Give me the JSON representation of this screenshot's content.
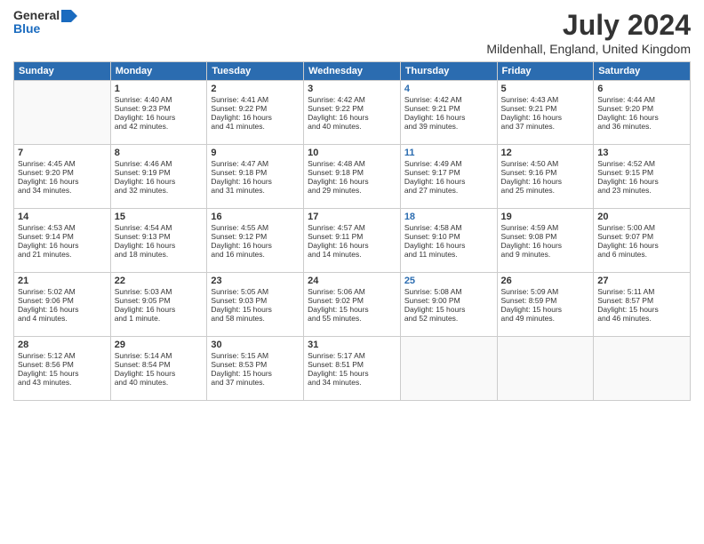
{
  "header": {
    "logo_general": "General",
    "logo_blue": "Blue",
    "main_title": "July 2024",
    "subtitle": "Mildenhall, England, United Kingdom"
  },
  "days_of_week": [
    "Sunday",
    "Monday",
    "Tuesday",
    "Wednesday",
    "Thursday",
    "Friday",
    "Saturday"
  ],
  "weeks": [
    [
      {
        "day": "",
        "content": ""
      },
      {
        "day": "1",
        "content": "Sunrise: 4:40 AM\nSunset: 9:23 PM\nDaylight: 16 hours\nand 42 minutes."
      },
      {
        "day": "2",
        "content": "Sunrise: 4:41 AM\nSunset: 9:22 PM\nDaylight: 16 hours\nand 41 minutes."
      },
      {
        "day": "3",
        "content": "Sunrise: 4:42 AM\nSunset: 9:22 PM\nDaylight: 16 hours\nand 40 minutes."
      },
      {
        "day": "4",
        "content": "Sunrise: 4:42 AM\nSunset: 9:21 PM\nDaylight: 16 hours\nand 39 minutes.",
        "thursday": true
      },
      {
        "day": "5",
        "content": "Sunrise: 4:43 AM\nSunset: 9:21 PM\nDaylight: 16 hours\nand 37 minutes."
      },
      {
        "day": "6",
        "content": "Sunrise: 4:44 AM\nSunset: 9:20 PM\nDaylight: 16 hours\nand 36 minutes."
      }
    ],
    [
      {
        "day": "7",
        "content": "Sunrise: 4:45 AM\nSunset: 9:20 PM\nDaylight: 16 hours\nand 34 minutes."
      },
      {
        "day": "8",
        "content": "Sunrise: 4:46 AM\nSunset: 9:19 PM\nDaylight: 16 hours\nand 32 minutes."
      },
      {
        "day": "9",
        "content": "Sunrise: 4:47 AM\nSunset: 9:18 PM\nDaylight: 16 hours\nand 31 minutes."
      },
      {
        "day": "10",
        "content": "Sunrise: 4:48 AM\nSunset: 9:18 PM\nDaylight: 16 hours\nand 29 minutes."
      },
      {
        "day": "11",
        "content": "Sunrise: 4:49 AM\nSunset: 9:17 PM\nDaylight: 16 hours\nand 27 minutes.",
        "thursday": true
      },
      {
        "day": "12",
        "content": "Sunrise: 4:50 AM\nSunset: 9:16 PM\nDaylight: 16 hours\nand 25 minutes."
      },
      {
        "day": "13",
        "content": "Sunrise: 4:52 AM\nSunset: 9:15 PM\nDaylight: 16 hours\nand 23 minutes."
      }
    ],
    [
      {
        "day": "14",
        "content": "Sunrise: 4:53 AM\nSunset: 9:14 PM\nDaylight: 16 hours\nand 21 minutes."
      },
      {
        "day": "15",
        "content": "Sunrise: 4:54 AM\nSunset: 9:13 PM\nDaylight: 16 hours\nand 18 minutes."
      },
      {
        "day": "16",
        "content": "Sunrise: 4:55 AM\nSunset: 9:12 PM\nDaylight: 16 hours\nand 16 minutes."
      },
      {
        "day": "17",
        "content": "Sunrise: 4:57 AM\nSunset: 9:11 PM\nDaylight: 16 hours\nand 14 minutes."
      },
      {
        "day": "18",
        "content": "Sunrise: 4:58 AM\nSunset: 9:10 PM\nDaylight: 16 hours\nand 11 minutes.",
        "thursday": true
      },
      {
        "day": "19",
        "content": "Sunrise: 4:59 AM\nSunset: 9:08 PM\nDaylight: 16 hours\nand 9 minutes."
      },
      {
        "day": "20",
        "content": "Sunrise: 5:00 AM\nSunset: 9:07 PM\nDaylight: 16 hours\nand 6 minutes."
      }
    ],
    [
      {
        "day": "21",
        "content": "Sunrise: 5:02 AM\nSunset: 9:06 PM\nDaylight: 16 hours\nand 4 minutes."
      },
      {
        "day": "22",
        "content": "Sunrise: 5:03 AM\nSunset: 9:05 PM\nDaylight: 16 hours\nand 1 minute."
      },
      {
        "day": "23",
        "content": "Sunrise: 5:05 AM\nSunset: 9:03 PM\nDaylight: 15 hours\nand 58 minutes."
      },
      {
        "day": "24",
        "content": "Sunrise: 5:06 AM\nSunset: 9:02 PM\nDaylight: 15 hours\nand 55 minutes."
      },
      {
        "day": "25",
        "content": "Sunrise: 5:08 AM\nSunset: 9:00 PM\nDaylight: 15 hours\nand 52 minutes.",
        "thursday": true
      },
      {
        "day": "26",
        "content": "Sunrise: 5:09 AM\nSunset: 8:59 PM\nDaylight: 15 hours\nand 49 minutes."
      },
      {
        "day": "27",
        "content": "Sunrise: 5:11 AM\nSunset: 8:57 PM\nDaylight: 15 hours\nand 46 minutes."
      }
    ],
    [
      {
        "day": "28",
        "content": "Sunrise: 5:12 AM\nSunset: 8:56 PM\nDaylight: 15 hours\nand 43 minutes."
      },
      {
        "day": "29",
        "content": "Sunrise: 5:14 AM\nSunset: 8:54 PM\nDaylight: 15 hours\nand 40 minutes."
      },
      {
        "day": "30",
        "content": "Sunrise: 5:15 AM\nSunset: 8:53 PM\nDaylight: 15 hours\nand 37 minutes."
      },
      {
        "day": "31",
        "content": "Sunrise: 5:17 AM\nSunset: 8:51 PM\nDaylight: 15 hours\nand 34 minutes."
      },
      {
        "day": "",
        "content": ""
      },
      {
        "day": "",
        "content": ""
      },
      {
        "day": "",
        "content": ""
      }
    ]
  ]
}
